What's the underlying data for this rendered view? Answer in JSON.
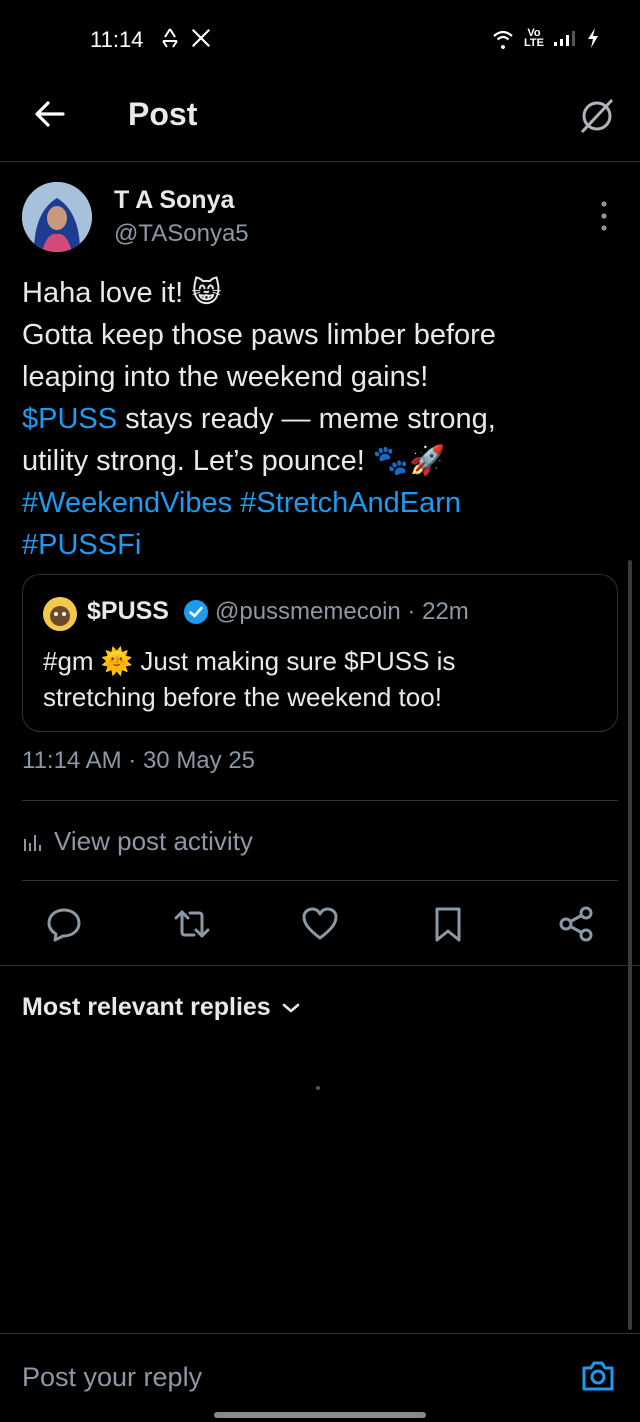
{
  "status_bar": {
    "time": "11:14",
    "left_icons": [
      "recycle-icon",
      "x-logo-icon"
    ],
    "network_label_top": "Vo",
    "network_label_bottom": "LTE",
    "right_icons": [
      "wifi-icon",
      "cell-signal-icon",
      "charging-icon"
    ]
  },
  "header": {
    "title": "Post",
    "back_icon": "arrow-left-icon",
    "grok_icon": "grok-icon"
  },
  "post": {
    "author_name": "T A Sonya",
    "author_handle": "@TASonya5",
    "text_lines": [
      "Haha love it! 😸",
      "Gotta keep those paws limber before",
      "leaping into the weekend gains!"
    ],
    "cashtag": "$PUSS",
    "line4_rest": " stays ready — meme strong,",
    "line5": "utility strong. Let’s pounce! 🐾🚀",
    "hashtags_line1": "#WeekendVibes #StretchAndEarn",
    "hashtags_line2": "#PUSSFi",
    "timestamp": "11:14 AM · 30 May 25",
    "view_activity": "View post activity"
  },
  "quote": {
    "name": "$PUSS",
    "handle_time": "@pussmemecoin · 22m",
    "text_line1": "#gm 🌞 Just making sure $PUSS is",
    "text_line2": "stretching before the weekend too!"
  },
  "actions": [
    "reply-icon",
    "retweet-icon",
    "like-icon",
    "bookmark-icon",
    "share-icon"
  ],
  "replies": {
    "sort_label": "Most relevant replies"
  },
  "reply_bar": {
    "placeholder": "Post your reply"
  },
  "colors": {
    "background": "#000000",
    "text": "#e7e9ea",
    "secondary": "#8b98a5",
    "link": "#1d9bf0",
    "border": "#2f3336"
  }
}
